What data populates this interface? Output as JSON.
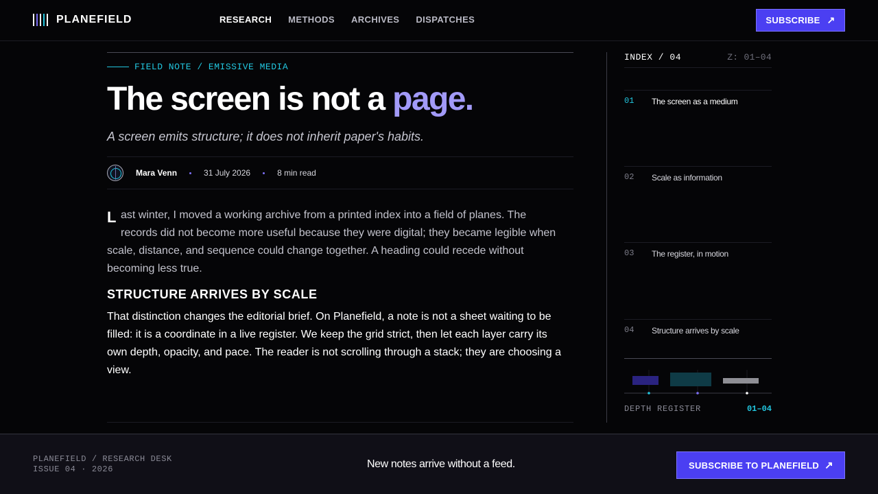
{
  "brand": {
    "name": "PLANEFIELD"
  },
  "nav": {
    "items": [
      {
        "label": "RESEARCH",
        "active": true
      },
      {
        "label": "METHODS",
        "active": false
      },
      {
        "label": "ARCHIVES",
        "active": false
      },
      {
        "label": "DISPATCHES",
        "active": false
      }
    ],
    "subscribe_label": "SUBSCRIBE"
  },
  "article": {
    "kicker": "FIELD NOTE / EMISSIVE MEDIA",
    "title_main": "The screen is not a ",
    "title_accent": "page.",
    "dek": "A screen emits structure; it does not inherit paper's habits.",
    "author": "Mara Venn",
    "date": "31 July 2026",
    "read_time": "8 min read",
    "dropcap": "L",
    "paragraph1": "ast winter, I moved a working archive from a printed index into a field of planes. The records did not become more useful because they were digital; they became legible when scale, distance, and sequence could change together. A heading could recede without becoming less true.",
    "subheading": "STRUCTURE ARRIVES BY SCALE",
    "paragraph2": "That distinction changes the editorial brief. On Planefield, a note is not a sheet waiting to be filled: it is a coordinate in a live register. We keep the grid strict, then let each layer carry its own depth, opacity, and pace. The reader is not scrolling through a stack; they are choosing a view."
  },
  "index": {
    "title": "INDEX / 04",
    "range": "Z: 01–04",
    "items": [
      {
        "num": "01",
        "label": "The screen as a medium",
        "active": true
      },
      {
        "num": "02",
        "label": "Scale as information",
        "active": false
      },
      {
        "num": "03",
        "label": "The register, in motion",
        "active": false
      },
      {
        "num": "04",
        "label": "Structure arrives by scale",
        "active": false
      }
    ],
    "depth_label": "DEPTH REGISTER",
    "depth_range": "01–04",
    "colors": {
      "cyan": "#22c7e0",
      "violet": "#7c6ff5",
      "white": "#ffffff"
    }
  },
  "footer": {
    "line1": "PLANEFIELD / RESEARCH DESK",
    "line2": "ISSUE 04 · 2026",
    "tagline": "New notes arrive without a feed.",
    "cta_label": "SUBSCRIBE TO PLANEFIELD"
  },
  "colors": {
    "accent": "#4b3ff2",
    "cyan": "#22c7e0",
    "lavender": "#a29af8",
    "background": "#050507"
  },
  "icons": {
    "arrow": "arrow-up-right-icon",
    "logo": "planefield-logo-icon"
  }
}
